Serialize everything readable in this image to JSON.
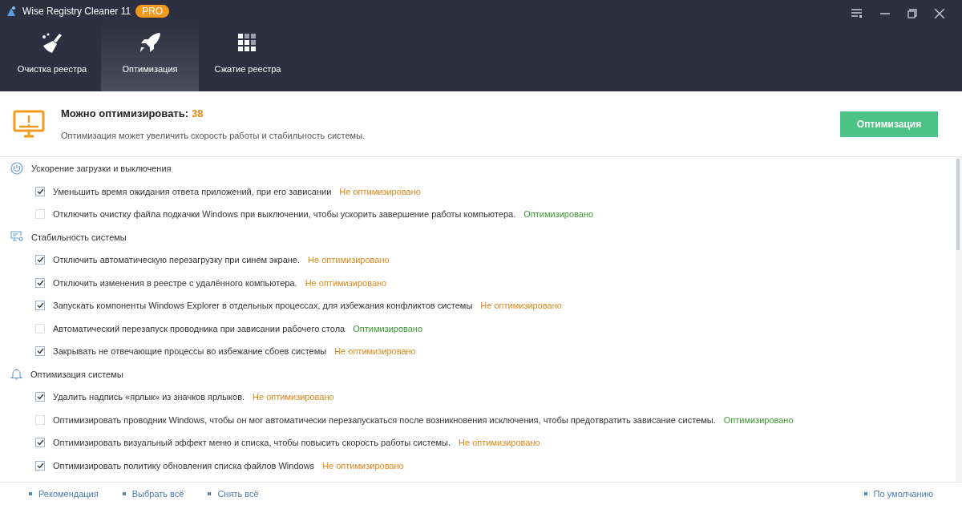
{
  "window": {
    "title": "Wise Registry Cleaner 11",
    "badge": "PRO"
  },
  "tabs": [
    {
      "label": "Очистка реестра",
      "kind": "broom",
      "selected": false
    },
    {
      "label": "Оптимизация",
      "kind": "rocket",
      "selected": true
    },
    {
      "label": "Сжатие реестра",
      "kind": "grid",
      "selected": false
    }
  ],
  "summary": {
    "title": "Можно оптимизировать:",
    "count": "38",
    "description": "Оптимизация может увеличить скорость работы и стабильность системы.",
    "button": "Оптимизация"
  },
  "groups": [
    {
      "title": "Ускорение загрузки и выключения",
      "kind": "power",
      "items": [
        {
          "label": "Уменьшить время ожидания ответа приложений, при его зависании",
          "checked": true,
          "optimized": false,
          "status": "Не оптимизировано"
        },
        {
          "label": "Отключить очистку файла подкачки Windows при выключении, чтобы ускорить завершение работы компьютера.",
          "checked": false,
          "optimized": true,
          "status": "Оптимизировано"
        }
      ]
    },
    {
      "title": "Стабильность системы",
      "kind": "monitor",
      "items": [
        {
          "label": "Отключить автоматическую перезагрузку при синем экране.",
          "checked": true,
          "optimized": false,
          "status": "Не оптимизировано"
        },
        {
          "label": "Отключить изменения в реестре с удалённого компьютера.",
          "checked": true,
          "optimized": false,
          "status": "Не оптимизировано"
        },
        {
          "label": "Запускать компоненты Windows Explorer в отдельных процессах, для избежания конфликтов системы",
          "checked": true,
          "optimized": false,
          "status": "Не оптимизировано"
        },
        {
          "label": "Автоматический перезапуск проводника при зависании рабочего стола",
          "checked": false,
          "optimized": true,
          "status": "Оптимизировано"
        },
        {
          "label": "Закрывать не отвечающие процессы во избежание сбоев системы",
          "checked": true,
          "optimized": false,
          "status": "Не оптимизировано"
        }
      ]
    },
    {
      "title": "Оптимизация системы",
      "kind": "bell",
      "items": [
        {
          "label": "Удалить надпись «ярлык» из значков ярлыков.",
          "checked": true,
          "optimized": false,
          "status": "Не оптимизировано"
        },
        {
          "label": "Оптимизировать проводник Windows, чтобы он мог автоматически перезапускаться после возникновения исключения, чтобы предотвратить зависание системы.",
          "checked": false,
          "optimized": true,
          "status": "Оптимизировано"
        },
        {
          "label": "Оптимизировать визуальный эффект меню и списка, чтобы повысить скорость работы системы.",
          "checked": true,
          "optimized": false,
          "status": "Не оптимизировано"
        },
        {
          "label": "Оптимизировать политику обновления списка файлов Windows",
          "checked": true,
          "optimized": false,
          "status": "Не оптимизировано"
        }
      ]
    }
  ],
  "footer": {
    "links": [
      "Рекомендация",
      "Выбрать всё",
      "Снять всё"
    ],
    "right_link": "По умолчанию"
  }
}
